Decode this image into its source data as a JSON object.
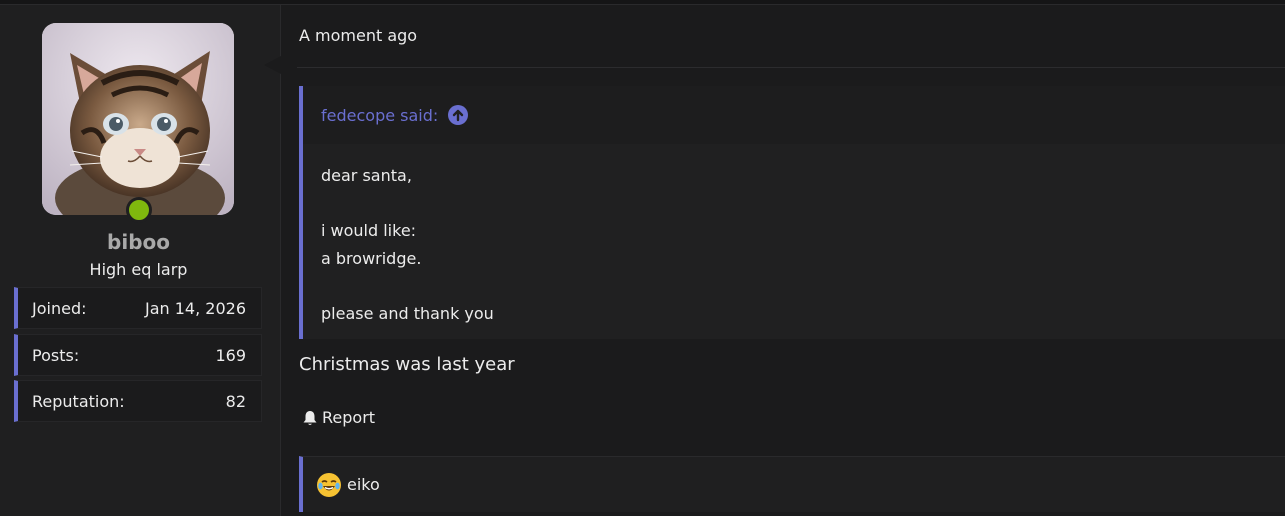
{
  "post": {
    "timestamp": "A moment ago",
    "message": "Christmas was last year",
    "report_label": "Report"
  },
  "user": {
    "name": "biboo",
    "title": "High eq larp",
    "online": true,
    "stats": [
      {
        "label": "Joined:",
        "value": "Jan 14, 2026"
      },
      {
        "label": "Posts:",
        "value": "169"
      },
      {
        "label": "Reputation:",
        "value": "82"
      }
    ]
  },
  "quote": {
    "author_line": "fedecope said:",
    "lines": {
      "l1": "dear santa,",
      "l2": "i would like:",
      "l3": "a browridge.",
      "l4": "please and thank you"
    }
  },
  "reactions": {
    "emoji_icon": "crying-laughing-emoji-icon",
    "user": "eiko"
  },
  "colors": {
    "accent": "#6a6fd0",
    "online": "#7fb80e",
    "background": "#1b1b1c"
  }
}
